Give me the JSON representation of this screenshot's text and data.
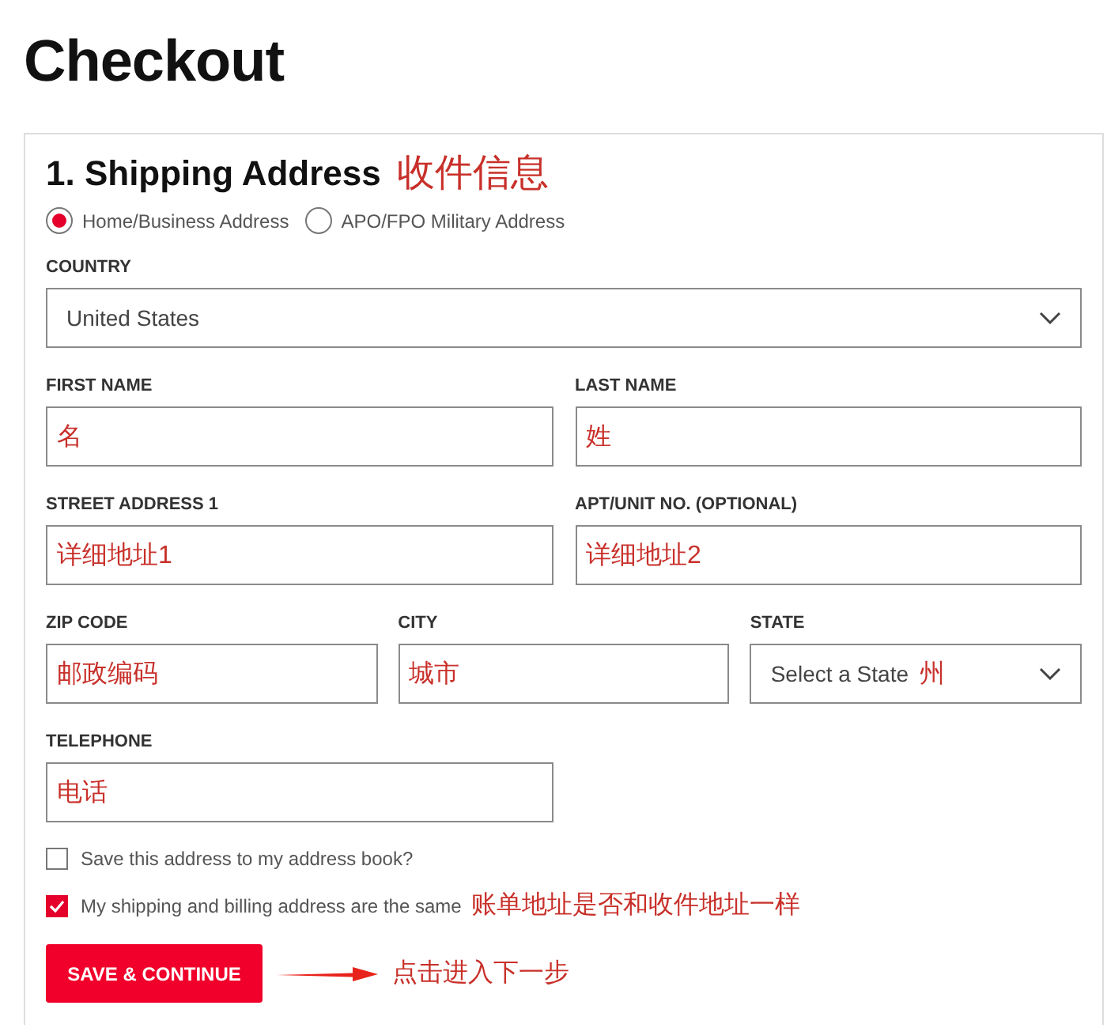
{
  "title": "Checkout",
  "section": {
    "heading": "1. Shipping Address",
    "note": "收件信息"
  },
  "address_types": [
    {
      "label": "Home/Business Address",
      "selected": true
    },
    {
      "label": "APO/FPO Military Address",
      "selected": false
    }
  ],
  "field_rows": [
    [
      {
        "kind": "select",
        "label": "COUNTRY",
        "value": "United States"
      }
    ],
    [
      {
        "kind": "text",
        "label": "FIRST NAME",
        "value": "名"
      },
      {
        "kind": "text",
        "label": "LAST NAME",
        "value": "姓"
      }
    ],
    [
      {
        "kind": "text",
        "label": "STREET ADDRESS 1",
        "value": "详细地址1"
      },
      {
        "kind": "text",
        "label": "APT/UNIT NO. (OPTIONAL)",
        "value": "详细地址2"
      }
    ],
    [
      {
        "kind": "text",
        "label": "ZIP CODE",
        "value": "邮政编码"
      },
      {
        "kind": "text",
        "label": "CITY",
        "value": "城市"
      },
      {
        "kind": "select",
        "label": "STATE",
        "value": "Select a State",
        "note": "州"
      }
    ],
    [
      {
        "kind": "text",
        "label": "TELEPHONE",
        "value": "电话"
      }
    ]
  ],
  "checkboxes": [
    {
      "label": "Save this address to my address book?",
      "checked": false
    },
    {
      "label": "My shipping and billing address are the same",
      "checked": true,
      "note": "账单地址是否和收件地址一样"
    }
  ],
  "submit": {
    "label": "SAVE & CONTINUE",
    "note": "点击进入下一步"
  }
}
